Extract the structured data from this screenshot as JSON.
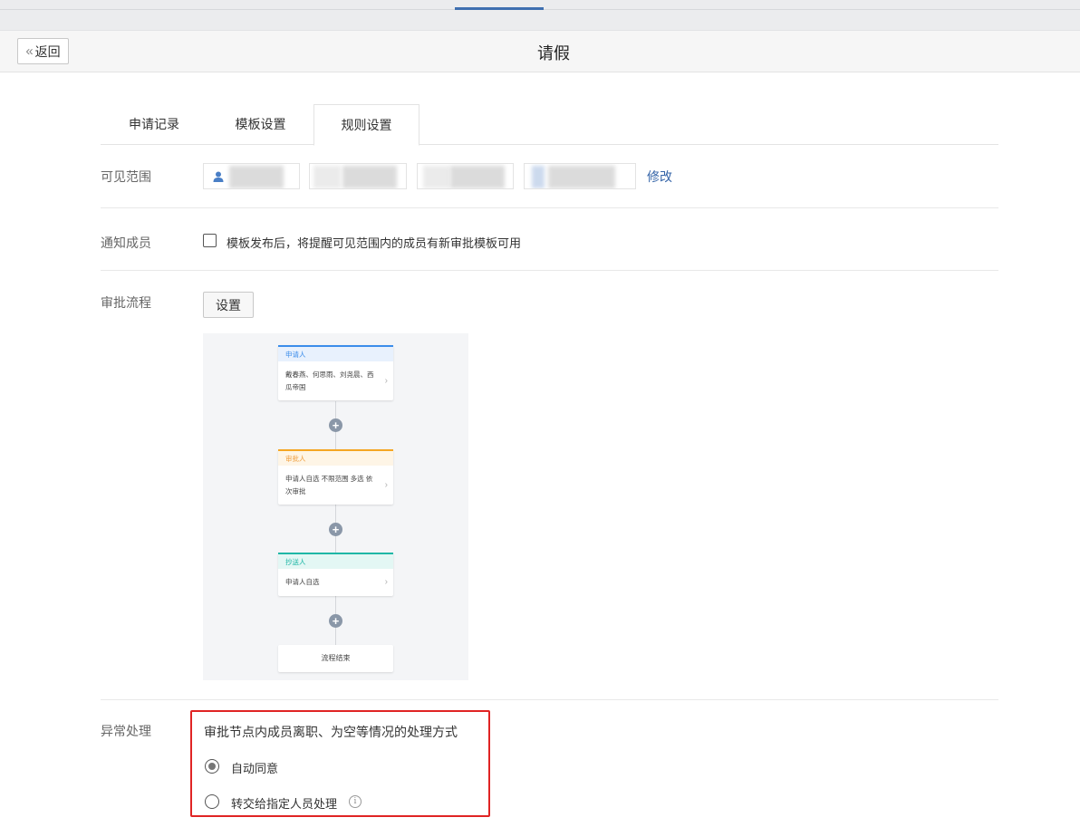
{
  "header": {
    "back_label": "返回",
    "title": "请假"
  },
  "tabs": [
    {
      "label": "申请记录",
      "active": false
    },
    {
      "label": "模板设置",
      "active": false
    },
    {
      "label": "规则设置",
      "active": true
    }
  ],
  "visibility": {
    "label": "可见范围",
    "edit_label": "修改"
  },
  "notify": {
    "label": "通知成员",
    "checkbox_text": "模板发布后，将提醒可见范围内的成员有新审批模板可用",
    "checked": false
  },
  "approval_flow": {
    "label": "审批流程",
    "setting_button": "设置",
    "nodes": [
      {
        "title": "申请人",
        "body": "戴春燕、何思雨、刘尧晨、西瓜帝国",
        "color": "#3c8dea"
      },
      {
        "title": "审批人",
        "body": "申请人自选 不限范围 多选 依次审批",
        "color": "#f5a623"
      },
      {
        "title": "抄送人",
        "body": "申请人自选",
        "color": "#1fb7a6"
      }
    ],
    "end_label": "流程结束"
  },
  "exception": {
    "label": "异常处理",
    "description": "审批节点内成员离职、为空等情况的处理方式",
    "options": [
      {
        "label": "自动同意",
        "selected": true
      },
      {
        "label": "转交给指定人员处理",
        "selected": false
      }
    ],
    "highlight_color": "#e02424"
  }
}
